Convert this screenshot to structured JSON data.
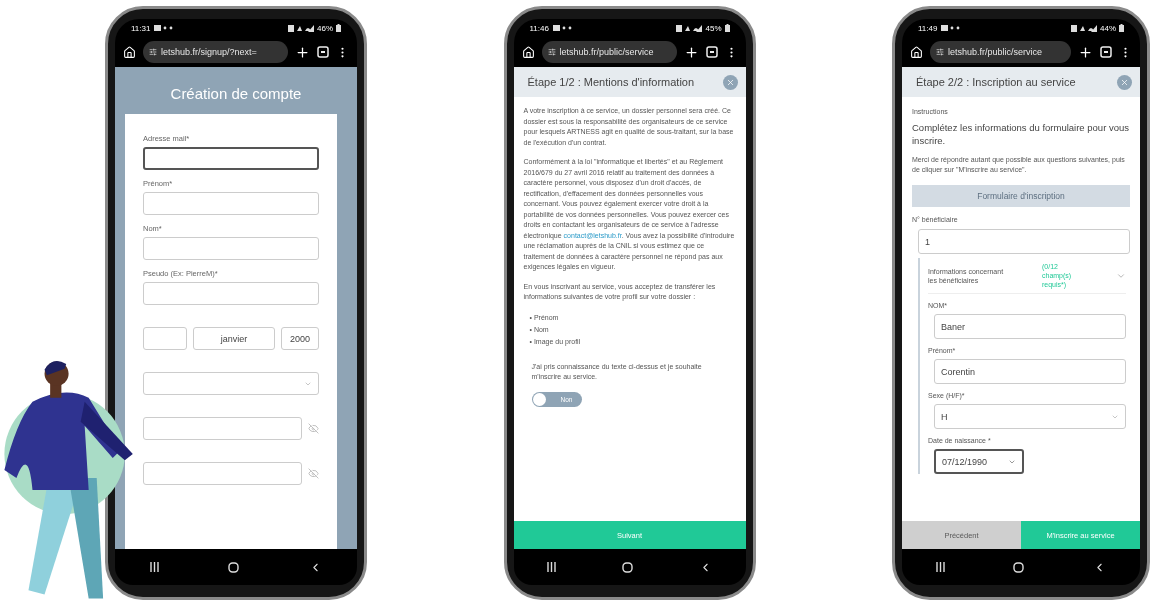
{
  "signup_phone": {
    "status_bar": {
      "time": "11:31",
      "battery": "46%"
    },
    "url": "letshub.fr/signup/?next=",
    "title": "Création de compte",
    "fields": [
      {
        "kind": "text",
        "label": "Adresse mail*",
        "focused": true
      },
      {
        "kind": "text",
        "label": "Prénom*",
        "focused": false
      },
      {
        "kind": "text",
        "label": "Nom*",
        "focused": false
      },
      {
        "kind": "text",
        "label": "Pseudo (Ex: PierreM)*",
        "focused": false
      },
      {
        "kind": "date",
        "parts": [
          "janvier",
          "2000"
        ]
      },
      {
        "kind": "select"
      },
      {
        "kind": "password"
      },
      {
        "kind": "password"
      }
    ]
  },
  "information_phone": {
    "status_bar": {
      "time": "11:46",
      "battery": "45%"
    },
    "url": "letshub.fr/public/service",
    "title": "Étape 1/2 : Mentions d'information",
    "paragraph_1": "A votre inscription à ce service, un dossier personnel sera créé. Ce dossier est sous la responsabilité des organisateurs de ce service pour lesquels ARTNESS agit en qualité de sous-traitant, sur la base de l'exécution d'un contrat.",
    "paragraph_2": {
      "before": "Conformément à la loi \"informatique et libertés\" et au Règlement 2016/679 du 27 avril 2016 relatif au traitement des données à caractère personnel, vous disposez d'un droit d'accès, de rectification, d'effacement des données personnelles vous concernant. Vous pouvez également exercer votre droit à la portabilité de vos données personnelles. Vous pouvez exercer ces droits en contactant les organisateurs de ce service à l'adresse électronique",
      "link": "contact@letshub.fr",
      "after": ". Vous avez la possibilité d'introduire une réclamation auprès de la CNIL si vous estimez que ce traitement de données à caractère personnel ne répond pas aux exigences légales en vigueur."
    },
    "paragraph_3": "En vous inscrivant au service, vous acceptez de transférer les informations suivantes de votre profil sur votre dossier :",
    "items": [
      "• Prénom",
      "• Nom",
      "• Image du profil"
    ],
    "consent": "J'ai pris connaissance du texte ci-dessus et je souhaite m'inscrire au service.",
    "toggle": {
      "on": false,
      "label": "Non"
    },
    "next_button": "Suivant"
  },
  "registration_phone": {
    "status_bar": {
      "time": "11:49",
      "battery": "44%"
    },
    "url": "letshub.fr/public/service",
    "title": "Étape 2/2 : Inscription au service",
    "instructions_label": "Instructions",
    "instructions": "Complétez les informations du formulaire pour vous inscrire.",
    "note": "Merci de répondre autant que possible aux questions suivantes, puis de cliquer sur \"M'inscrire au service\".",
    "form_title": "Formulaire d'inscription",
    "beneficiary": {
      "label": "N° bénéficiaire",
      "value": "1"
    },
    "section": {
      "title": "Informations concernant les bénéficiaires",
      "required": "(0/12 champ(s) requis*)",
      "expanded": true,
      "fields": [
        {
          "kind": "text",
          "label": "NOM*",
          "value": "Baner"
        },
        {
          "kind": "text",
          "label": "Prénom*",
          "value": "Corentin"
        },
        {
          "kind": "select",
          "label": "Sexe (H/F)*",
          "value": "H"
        },
        {
          "kind": "date",
          "label": "Date de naissance *",
          "value": "07/12/1990"
        }
      ]
    },
    "buttons": [
      {
        "label": "Précédent",
        "disabled": true
      },
      {
        "label": "M'inscrire au service",
        "disabled": false
      }
    ]
  }
}
